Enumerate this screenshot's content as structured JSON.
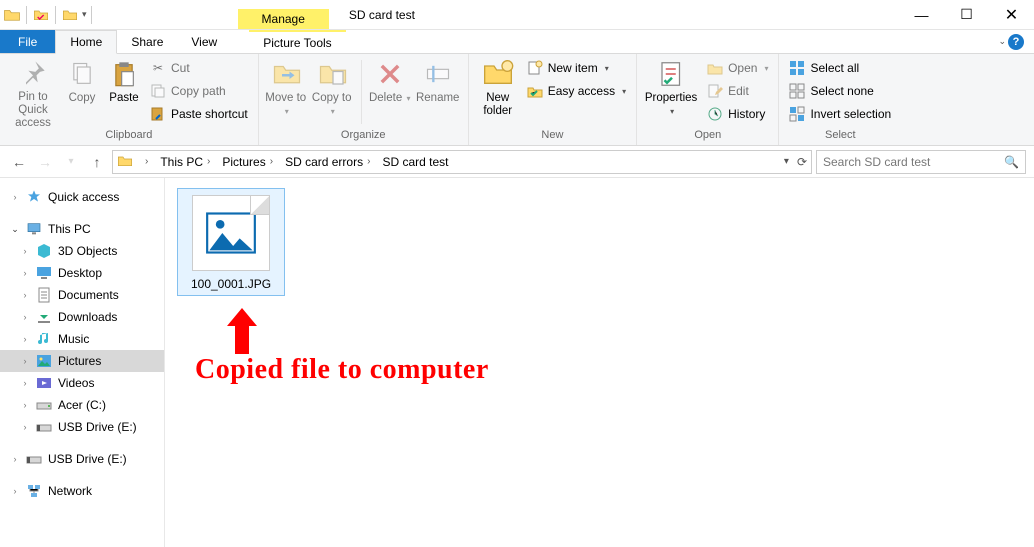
{
  "title": {
    "contextual_tab": "Manage",
    "window_title": "SD card test"
  },
  "tabs": {
    "file": "File",
    "home": "Home",
    "share": "Share",
    "view": "View",
    "picture_tools": "Picture Tools"
  },
  "ribbon": {
    "clipboard": {
      "title": "Clipboard",
      "pin": "Pin to Quick access",
      "copy": "Copy",
      "paste": "Paste",
      "cut": "Cut",
      "copy_path": "Copy path",
      "paste_shortcut": "Paste shortcut"
    },
    "organize": {
      "title": "Organize",
      "move_to": "Move to",
      "copy_to": "Copy to",
      "delete": "Delete",
      "rename": "Rename"
    },
    "new": {
      "title": "New",
      "new_folder": "New folder",
      "new_item": "New item",
      "easy_access": "Easy access"
    },
    "open": {
      "title": "Open",
      "properties": "Properties",
      "open": "Open",
      "edit": "Edit",
      "history": "History"
    },
    "select": {
      "title": "Select",
      "select_all": "Select all",
      "select_none": "Select none",
      "invert": "Invert selection"
    }
  },
  "breadcrumbs": [
    "This PC",
    "Pictures",
    "SD card errors",
    "SD card test"
  ],
  "search": {
    "placeholder": "Search SD card test"
  },
  "sidebar": {
    "quick_access": "Quick access",
    "this_pc": "This PC",
    "items": [
      {
        "label": "3D Objects"
      },
      {
        "label": "Desktop"
      },
      {
        "label": "Documents"
      },
      {
        "label": "Downloads"
      },
      {
        "label": "Music"
      },
      {
        "label": "Pictures"
      },
      {
        "label": "Videos"
      },
      {
        "label": "Acer (C:)"
      },
      {
        "label": "USB Drive (E:)"
      }
    ],
    "usb_drive": "USB Drive (E:)",
    "network": "Network"
  },
  "files": [
    {
      "name": "100_0001.JPG"
    }
  ],
  "annotation": "Copied file to computer"
}
